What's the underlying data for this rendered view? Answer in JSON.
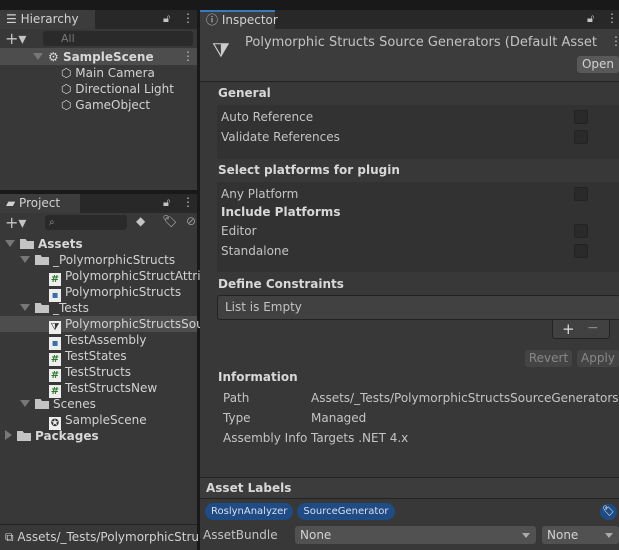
{
  "hierarchy": {
    "tab": "Hierarchy",
    "search_placeholder": "All",
    "scene": "SampleScene",
    "items": [
      "Main Camera",
      "Directional Light",
      "GameObject"
    ]
  },
  "project": {
    "tab": "Project",
    "tree": [
      {
        "label": "Assets",
        "depth": 0,
        "icon": "folder-open",
        "bold": true
      },
      {
        "label": "_PolymorphicStructs",
        "depth": 1,
        "icon": "folder-open"
      },
      {
        "label": "PolymorphicStructAttrib",
        "depth": 2,
        "icon": "cs-script"
      },
      {
        "label": "PolymorphicStructs",
        "depth": 2,
        "icon": "assembly-definition"
      },
      {
        "label": "_Tests",
        "depth": 1,
        "icon": "folder-open"
      },
      {
        "label": "PolymorphicStructsSour",
        "depth": 2,
        "icon": "plugin",
        "selected": true
      },
      {
        "label": "TestAssembly",
        "depth": 2,
        "icon": "assembly-definition"
      },
      {
        "label": "TestStates",
        "depth": 2,
        "icon": "cs-script"
      },
      {
        "label": "TestStructs",
        "depth": 2,
        "icon": "cs-script"
      },
      {
        "label": "TestStructsNew",
        "depth": 2,
        "icon": "cs-script"
      },
      {
        "label": "Scenes",
        "depth": 1,
        "icon": "folder-open"
      },
      {
        "label": "SampleScene",
        "depth": 2,
        "icon": "scene"
      },
      {
        "label": "Packages",
        "depth": 0,
        "icon": "folder-closed",
        "bold": true,
        "collapsed": true
      }
    ],
    "status_path": "Assets/_Tests/PolymorphicStru"
  },
  "inspector": {
    "tab": "Inspector",
    "title": "Polymorphic Structs Source Generators (Default Asset",
    "open": "Open",
    "general": "General",
    "auto_reference": "Auto Reference",
    "validate_references": "Validate References",
    "select_platforms": "Select platforms for plugin",
    "any_platform": "Any Platform",
    "include_platforms": "Include Platforms",
    "editor": "Editor",
    "standalone": "Standalone",
    "define_constraints": "Define Constraints",
    "list_empty": "List is Empty",
    "plus": "+",
    "minus": "−",
    "revert": "Revert",
    "apply": "Apply",
    "information": "Information",
    "path_label": "Path",
    "path": "Assets/_Tests/PolymorphicStructsSourceGenerators.dl",
    "type_label": "Type",
    "type": "Managed",
    "assembly_label": "Assembly Info",
    "assembly": "Targets .NET 4.x",
    "asset_labels": "Asset Labels",
    "labels": [
      "RoslynAnalyzer",
      "SourceGenerator"
    ],
    "assetbundle_label": "AssetBundle",
    "bundle": "None",
    "variant": "None"
  },
  "colors": {
    "label_pill": "#1f4c85",
    "tab_accent": "#3a79bb"
  }
}
